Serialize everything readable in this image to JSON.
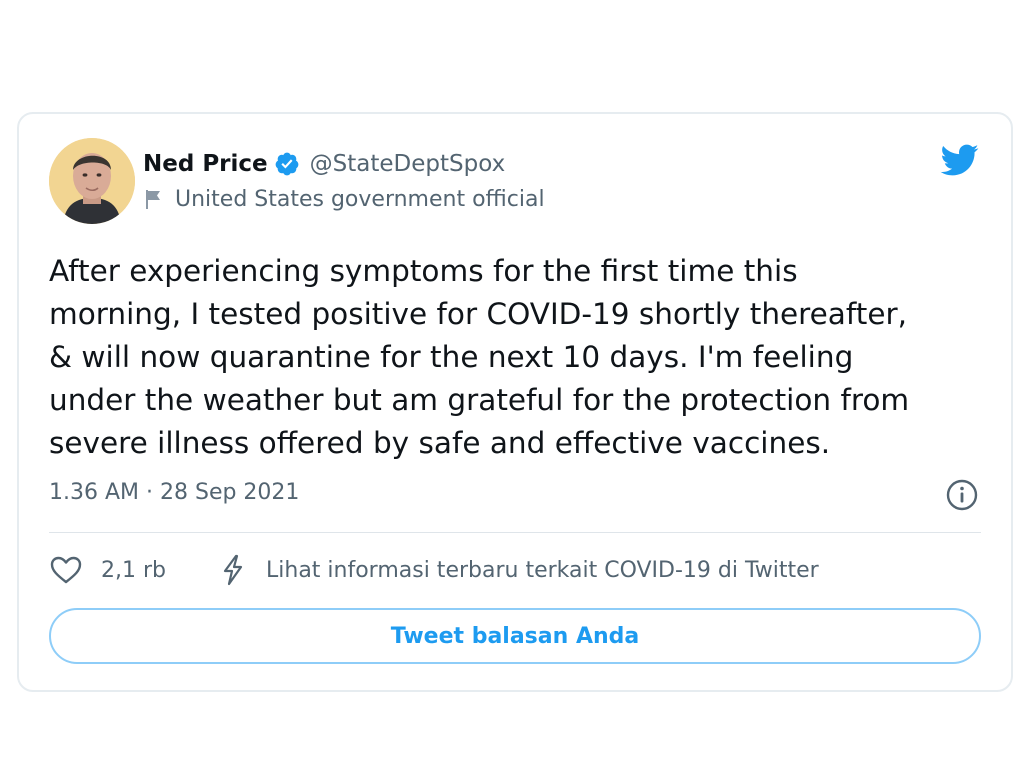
{
  "colors": {
    "twitter_blue": "#1d9bf0",
    "text_primary": "#0f1419",
    "text_secondary": "#536471",
    "border": "#e6ecf0",
    "reply_border": "#8ecdf8"
  },
  "author": {
    "display_name": "Ned Price",
    "handle": "@StateDeptSpox",
    "verified": true,
    "label": "United States government official",
    "avatar_icon": "profile-photo",
    "label_icon": "flag-icon"
  },
  "logo_icon": "twitter-bird-icon",
  "tweet": {
    "lines": [
      "After experiencing symptoms for the first time this",
      "morning, I tested positive for COVID-19 shortly thereafter,",
      "& will now quarantine for the next 10 days. I'm feeling",
      "under the weather but am grateful for the protection from",
      "severe illness offered by safe and effective vaccines."
    ],
    "timestamp": "1.36 AM · 28 Sep 2021",
    "info_icon": "info-icon"
  },
  "actions": {
    "like_icon": "heart-icon",
    "like_count": "2,1 rb",
    "covid_icon": "bolt-icon",
    "covid_link": "Lihat informasi terbaru terkait COVID-19 di Twitter"
  },
  "reply": {
    "label": "Tweet balasan Anda"
  }
}
